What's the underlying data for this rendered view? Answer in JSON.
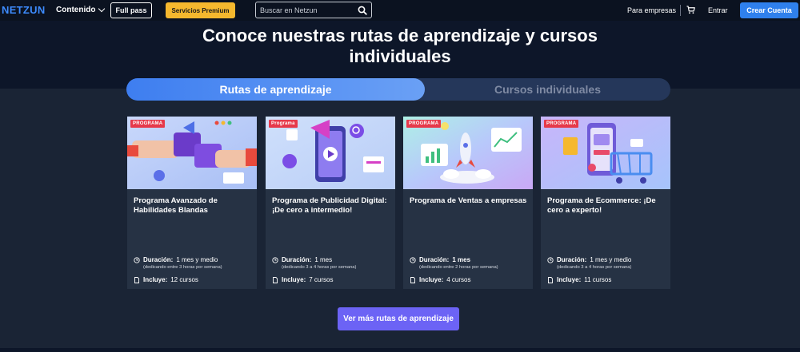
{
  "nav": {
    "logo": "NETZUN",
    "menu_contenido": "Contenido",
    "full_pass": "Full pass",
    "premium": "Servicios Premium",
    "search_placeholder": "Buscar en Netzun",
    "para_empresas": "Para empresas",
    "entrar": "Entrar",
    "crear_cuenta": "Crear Cuenta"
  },
  "hero": {
    "title": "Conoce nuestras rutas de aprendizaje y cursos individuales"
  },
  "tabs": [
    {
      "label": "Rutas de aprendizaje",
      "active": true
    },
    {
      "label": "Cursos individuales",
      "active": false
    }
  ],
  "cards": [
    {
      "badge": "PROGRAMA",
      "title": "Programa Avanzado de Habilidades Blandas",
      "duration_label": "Duración:",
      "duration_value": "1 mes y medio",
      "duration_note": "(dedicando entre 3 horas por semana)",
      "includes_label": "Incluye:",
      "includes_value": "12 cursos"
    },
    {
      "badge": "Programa",
      "title": "Programa de Publicidad Digital: ¡De cero a intermedio!",
      "duration_label": "Duración:",
      "duration_value": "1 mes",
      "duration_note": "(dedicando 3 a 4 horas por semana)",
      "includes_label": "Incluye:",
      "includes_value": "7 cursos"
    },
    {
      "badge": "PROGRAMA",
      "title": "Programa de Ventas a empresas",
      "duration_label": "Duración:",
      "duration_value": "1 mes",
      "duration_note": "(dedicando entre 2 horas por semana)",
      "includes_label": "Incluye:",
      "includes_value": "4 cursos"
    },
    {
      "badge": "PROGRAMA",
      "title": "Programa de Ecommerce: ¡De cero a experto!",
      "duration_label": "Duración:",
      "duration_value": "1 mes y medio",
      "duration_note": "(dedicando 3 a 4 horas por semana)",
      "includes_label": "Incluye:",
      "includes_value": "11 cursos"
    }
  ],
  "cta": {
    "ver_mas": "Ver más rutas de aprendizaje"
  },
  "colors": {
    "brand": "#3d8bfd",
    "premium": "#f5b82e",
    "primary_button": "#2f80ed",
    "cta": "#6c63f5",
    "badge": "#e6394a"
  },
  "icons": [
    "search-icon",
    "chevron-down-icon",
    "cart-icon",
    "clock-icon",
    "document-icon"
  ]
}
